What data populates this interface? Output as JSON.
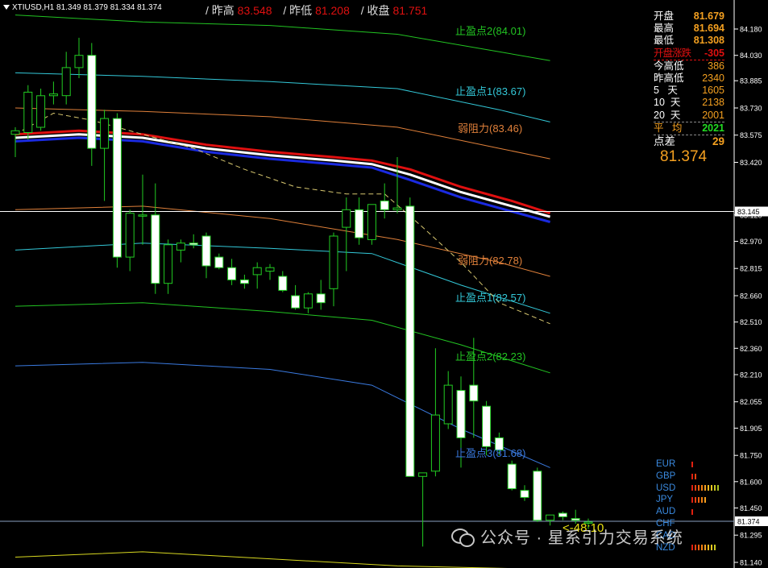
{
  "header": {
    "symbol_info": "XTIUSD,H1  81.349 81.379 81.334 81.374",
    "items": [
      {
        "label": "/ 昨高",
        "value": "83.548"
      },
      {
        "label": "/ 昨低",
        "value": "81.208"
      },
      {
        "label": "/ 收盘",
        "value": "81.751"
      }
    ]
  },
  "price_axis": {
    "ticks": [
      "84.180",
      "84.030",
      "83.885",
      "83.730",
      "83.575",
      "83.420",
      "83.120",
      "82.970",
      "82.815",
      "82.660",
      "82.510",
      "82.360",
      "82.210",
      "82.055",
      "81.905",
      "81.750",
      "81.600",
      "81.450",
      "81.295",
      "81.140"
    ],
    "current_price_label": "83.145",
    "last_price_label": "81.374"
  },
  "stats_panel": {
    "rows": [
      {
        "label": "开盘",
        "value": "81.679"
      },
      {
        "label": "最高",
        "value": "81.694"
      },
      {
        "label": "最低",
        "value": "81.308"
      },
      {
        "label": "开盘涨跌",
        "value": "-305"
      },
      {
        "label": "今高低",
        "value": "386"
      },
      {
        "label": "昨高低",
        "value": "2340"
      },
      {
        "label": "5   天",
        "value": "1605"
      },
      {
        "label": "10  天",
        "value": "2138"
      },
      {
        "label": "20  天",
        "value": "2001"
      },
      {
        "label": "平   均",
        "value": "2021"
      },
      {
        "label": "点差",
        "value": "29"
      }
    ],
    "big_price": "81.374"
  },
  "level_labels": [
    {
      "text": "止盈点2(84.01)",
      "color": "#22c422"
    },
    {
      "text": "止盈点1(83.67)",
      "color": "#33c8d8"
    },
    {
      "text": "弱阻力(83.46)",
      "color": "#e0803a"
    },
    {
      "text": "弱阻力(82.78)",
      "color": "#e0803a"
    },
    {
      "text": "止盈点1(82.57)",
      "color": "#33c8d8"
    },
    {
      "text": "止盈点2(82.23)",
      "color": "#22c422"
    },
    {
      "text": "止盈点3(81.68)",
      "color": "#3a7ae0"
    }
  ],
  "countdown": "<-48:10",
  "currency_strength": [
    {
      "name": "EUR",
      "bars": 1
    },
    {
      "name": "GBP",
      "bars": 2
    },
    {
      "name": "USD",
      "bars": 9
    },
    {
      "name": "JPY",
      "bars": 5
    },
    {
      "name": "AUD",
      "bars": 1
    },
    {
      "name": "CHF",
      "bars": 0
    },
    {
      "name": "CAD",
      "bars": 0
    },
    {
      "name": "NZD",
      "bars": 8
    }
  ],
  "watermark": "公众号 · 星系引力交易系统",
  "colors": {
    "bull": "#000000",
    "bear": "#ffffff",
    "wick": "#22cc22",
    "axis": "#ffffff",
    "accent_orange": "#f4a020",
    "red": "#e01010"
  },
  "chart_data": {
    "type": "candlestick",
    "symbol": "XTIUSD",
    "timeframe": "H1",
    "ylim": [
      81.14,
      84.18
    ],
    "candles": [
      {
        "o": 83.58,
        "h": 83.62,
        "l": 83.45,
        "c": 83.6
      },
      {
        "o": 83.59,
        "h": 83.86,
        "l": 83.55,
        "c": 83.82
      },
      {
        "o": 83.62,
        "h": 83.84,
        "l": 83.6,
        "c": 83.8
      },
      {
        "o": 83.8,
        "h": 83.88,
        "l": 83.75,
        "c": 83.81
      },
      {
        "o": 83.8,
        "h": 84.05,
        "l": 83.75,
        "c": 83.96
      },
      {
        "o": 83.96,
        "h": 84.13,
        "l": 83.9,
        "c": 84.03
      },
      {
        "o": 84.03,
        "h": 84.1,
        "l": 83.4,
        "c": 83.5
      },
      {
        "o": 83.5,
        "h": 83.72,
        "l": 83.2,
        "c": 83.67
      },
      {
        "o": 83.67,
        "h": 83.7,
        "l": 82.82,
        "c": 82.88
      },
      {
        "o": 82.88,
        "h": 83.15,
        "l": 82.8,
        "c": 83.13
      },
      {
        "o": 83.12,
        "h": 83.35,
        "l": 82.95,
        "c": 83.12
      },
      {
        "o": 83.12,
        "h": 83.3,
        "l": 82.67,
        "c": 82.73
      },
      {
        "o": 82.73,
        "h": 82.98,
        "l": 82.67,
        "c": 82.95
      },
      {
        "o": 82.92,
        "h": 82.98,
        "l": 82.85,
        "c": 82.96
      },
      {
        "o": 82.96,
        "h": 83.01,
        "l": 82.93,
        "c": 82.95
      },
      {
        "o": 83.0,
        "h": 83.02,
        "l": 82.76,
        "c": 82.83
      },
      {
        "o": 82.88,
        "h": 82.9,
        "l": 82.81,
        "c": 82.82
      },
      {
        "o": 82.82,
        "h": 82.87,
        "l": 82.72,
        "c": 82.75
      },
      {
        "o": 82.75,
        "h": 82.78,
        "l": 82.7,
        "c": 82.73
      },
      {
        "o": 82.78,
        "h": 82.85,
        "l": 82.7,
        "c": 82.82
      },
      {
        "o": 82.8,
        "h": 82.84,
        "l": 82.75,
        "c": 82.82
      },
      {
        "o": 82.77,
        "h": 82.8,
        "l": 82.68,
        "c": 82.69
      },
      {
        "o": 82.66,
        "h": 82.72,
        "l": 82.58,
        "c": 82.59
      },
      {
        "o": 82.59,
        "h": 82.68,
        "l": 82.56,
        "c": 82.67
      },
      {
        "o": 82.67,
        "h": 82.75,
        "l": 82.58,
        "c": 82.62
      },
      {
        "o": 82.7,
        "h": 83.02,
        "l": 82.6,
        "c": 83.0
      },
      {
        "o": 83.05,
        "h": 83.22,
        "l": 82.8,
        "c": 83.15
      },
      {
        "o": 83.15,
        "h": 83.22,
        "l": 82.95,
        "c": 82.99
      },
      {
        "o": 82.98,
        "h": 83.18,
        "l": 82.95,
        "c": 83.18
      },
      {
        "o": 83.2,
        "h": 83.3,
        "l": 83.1,
        "c": 83.15
      },
      {
        "o": 83.15,
        "h": 83.45,
        "l": 83.13,
        "c": 83.16
      },
      {
        "o": 83.17,
        "h": 83.22,
        "l": 81.65,
        "c": 81.63
      },
      {
        "o": 81.63,
        "h": 81.65,
        "l": 81.23,
        "c": 81.65
      },
      {
        "o": 81.66,
        "h": 82.36,
        "l": 81.63,
        "c": 81.98
      },
      {
        "o": 81.93,
        "h": 82.23,
        "l": 81.9,
        "c": 82.15
      },
      {
        "o": 82.12,
        "h": 82.2,
        "l": 81.68,
        "c": 81.85
      },
      {
        "o": 82.15,
        "h": 82.42,
        "l": 81.85,
        "c": 82.06
      },
      {
        "o": 82.03,
        "h": 82.06,
        "l": 81.75,
        "c": 81.8
      },
      {
        "o": 81.85,
        "h": 81.88,
        "l": 81.75,
        "c": 81.78
      },
      {
        "o": 81.7,
        "h": 81.72,
        "l": 81.55,
        "c": 81.56
      },
      {
        "o": 81.55,
        "h": 81.58,
        "l": 81.49,
        "c": 81.51
      },
      {
        "o": 81.66,
        "h": 81.68,
        "l": 81.37,
        "c": 81.38
      },
      {
        "o": 81.38,
        "h": 81.4,
        "l": 81.35,
        "c": 81.41
      },
      {
        "o": 81.42,
        "h": 81.43,
        "l": 81.38,
        "c": 81.4
      },
      {
        "o": 81.39,
        "h": 81.44,
        "l": 81.36,
        "c": 81.38
      },
      {
        "o": 81.37,
        "h": 81.39,
        "l": 81.33,
        "c": 81.37
      }
    ],
    "lines": [
      {
        "name": "tp2-upper",
        "color": "#22c422",
        "points": [
          [
            0,
            84.26
          ],
          [
            10,
            84.22
          ],
          [
            20,
            84.2
          ],
          [
            30,
            84.15
          ],
          [
            38,
            84.05
          ],
          [
            42,
            84.0
          ]
        ]
      },
      {
        "name": "tp1-upper",
        "color": "#33c8d8",
        "points": [
          [
            0,
            83.93
          ],
          [
            10,
            83.91
          ],
          [
            20,
            83.88
          ],
          [
            30,
            83.84
          ],
          [
            38,
            83.72
          ],
          [
            42,
            83.65
          ]
        ]
      },
      {
        "name": "weak-res-upper",
        "color": "#e0803a",
        "points": [
          [
            0,
            83.73
          ],
          [
            10,
            83.71
          ],
          [
            20,
            83.68
          ],
          [
            30,
            83.62
          ],
          [
            38,
            83.5
          ],
          [
            42,
            83.44
          ]
        ]
      },
      {
        "name": "weak-res-lower",
        "color": "#e0803a",
        "points": [
          [
            0,
            83.15
          ],
          [
            10,
            83.17
          ],
          [
            20,
            83.1
          ],
          [
            30,
            82.98
          ],
          [
            38,
            82.85
          ],
          [
            42,
            82.77
          ]
        ]
      },
      {
        "name": "tp1-lower",
        "color": "#33c8d8",
        "points": [
          [
            0,
            82.92
          ],
          [
            10,
            82.96
          ],
          [
            20,
            82.93
          ],
          [
            28,
            82.9
          ],
          [
            35,
            82.72
          ],
          [
            42,
            82.56
          ]
        ]
      },
      {
        "name": "tp2-lower",
        "color": "#22c422",
        "points": [
          [
            0,
            82.6
          ],
          [
            10,
            82.62
          ],
          [
            20,
            82.57
          ],
          [
            28,
            82.52
          ],
          [
            35,
            82.38
          ],
          [
            42,
            82.22
          ]
        ]
      },
      {
        "name": "tp3-lower",
        "color": "#3a7ae0",
        "points": [
          [
            0,
            82.26
          ],
          [
            10,
            82.28
          ],
          [
            20,
            82.24
          ],
          [
            28,
            82.15
          ],
          [
            35,
            81.9
          ],
          [
            42,
            81.68
          ]
        ]
      },
      {
        "name": "yellow-bottom",
        "color": "#d8d820",
        "points": [
          [
            0,
            81.17
          ],
          [
            10,
            81.2
          ],
          [
            20,
            81.16
          ],
          [
            30,
            81.12
          ],
          [
            42,
            81.1
          ]
        ]
      },
      {
        "name": "ma-red",
        "color": "#e01010",
        "width": 3,
        "points": [
          [
            0,
            83.58
          ],
          [
            5,
            83.6
          ],
          [
            10,
            83.58
          ],
          [
            15,
            83.52
          ],
          [
            20,
            83.48
          ],
          [
            25,
            83.45
          ],
          [
            28,
            83.43
          ],
          [
            31,
            83.38
          ],
          [
            35,
            83.28
          ],
          [
            39,
            83.2
          ],
          [
            42,
            83.13
          ]
        ]
      },
      {
        "name": "ma-white",
        "color": "#ffffff",
        "width": 3,
        "points": [
          [
            0,
            83.56
          ],
          [
            5,
            83.58
          ],
          [
            10,
            83.56
          ],
          [
            15,
            83.5
          ],
          [
            20,
            83.46
          ],
          [
            25,
            83.43
          ],
          [
            28,
            83.41
          ],
          [
            31,
            83.35
          ],
          [
            35,
            83.25
          ],
          [
            39,
            83.17
          ],
          [
            42,
            83.11
          ]
        ]
      },
      {
        "name": "ma-blue",
        "color": "#1a2ae0",
        "width": 3,
        "points": [
          [
            0,
            83.54
          ],
          [
            5,
            83.56
          ],
          [
            10,
            83.54
          ],
          [
            15,
            83.48
          ],
          [
            20,
            83.44
          ],
          [
            25,
            83.41
          ],
          [
            28,
            83.39
          ],
          [
            31,
            83.32
          ],
          [
            35,
            83.22
          ],
          [
            39,
            83.14
          ],
          [
            42,
            83.08
          ]
        ]
      },
      {
        "name": "dashed-ma",
        "color": "#d8c870",
        "dashed": true,
        "points": [
          [
            0,
            83.58
          ],
          [
            3,
            83.7
          ],
          [
            6,
            83.66
          ],
          [
            10,
            83.58
          ],
          [
            14,
            83.5
          ],
          [
            18,
            83.38
          ],
          [
            22,
            83.28
          ],
          [
            26,
            83.24
          ],
          [
            29,
            83.24
          ],
          [
            32,
            83.05
          ],
          [
            35,
            82.85
          ],
          [
            38,
            82.62
          ],
          [
            42,
            82.5
          ]
        ]
      }
    ],
    "hlines": [
      {
        "name": "current-line",
        "value": 83.14,
        "color": "#ffffff"
      },
      {
        "name": "last-price-line",
        "value": 81.374,
        "color": "#8aa0c0"
      }
    ]
  }
}
